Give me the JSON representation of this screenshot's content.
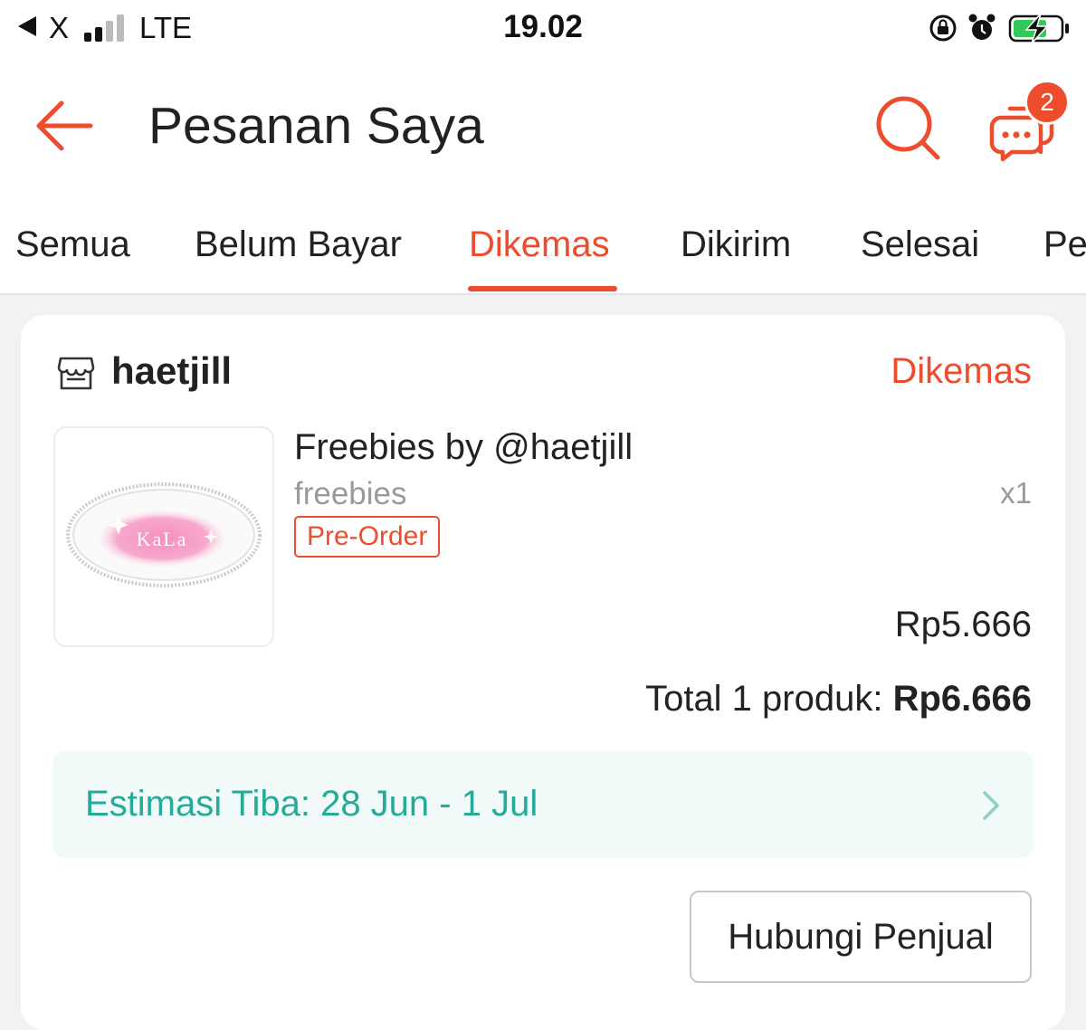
{
  "status_bar": {
    "carrier": "X",
    "network": "LTE",
    "time": "19.02",
    "icons": [
      "back-to-app-icon",
      "signal-icon",
      "rotation-lock-icon",
      "alarm-icon",
      "battery-charging-icon"
    ]
  },
  "header": {
    "title": "Pesanan Saya",
    "chat_badge_count": "2",
    "icons": [
      "back-arrow-icon",
      "search-icon",
      "chat-icon"
    ]
  },
  "tabs": [
    {
      "label": "Semua",
      "active": false
    },
    {
      "label": "Belum Bayar",
      "active": false
    },
    {
      "label": "Dikemas",
      "active": true
    },
    {
      "label": "Dikirim",
      "active": false
    },
    {
      "label": "Selesai",
      "active": false
    },
    {
      "label": "Pe",
      "active": false
    }
  ],
  "order": {
    "shop_name": "haetjill",
    "status": "Dikemas",
    "product": {
      "name": "Freebies by @haetjill",
      "variant": "freebies",
      "quantity": "x1",
      "tag": "Pre-Order",
      "price": "Rp5.666",
      "image_text": "KaLa"
    },
    "total_label": "Total 1 produk: ",
    "total_value": "Rp6.666",
    "eta": "Estimasi Tiba: 28 Jun - 1 Jul",
    "contact_button": "Hubungi Penjual"
  },
  "colors": {
    "accent": "#ee4d2d",
    "eta_text": "#26aa99",
    "eta_bg": "#f1faf8",
    "muted_text": "#9a9a9a"
  }
}
